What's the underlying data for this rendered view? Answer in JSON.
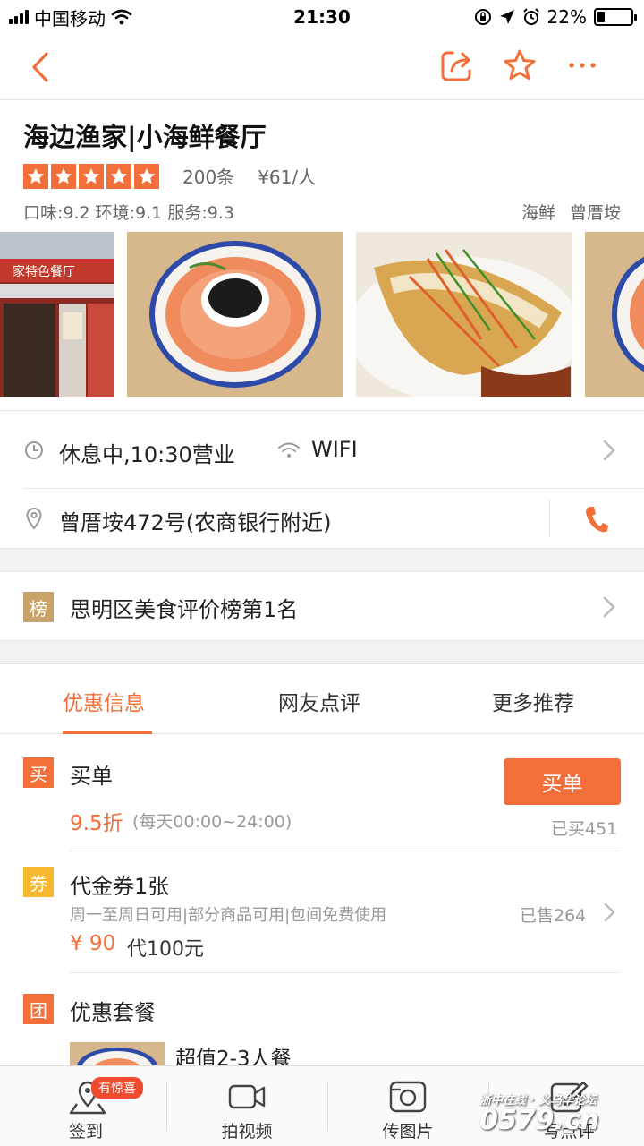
{
  "status_bar": {
    "carrier": "中国移动",
    "time": "21:30",
    "battery_percent_text": "22%",
    "battery_level": 0.22
  },
  "shop": {
    "title": "海边渔家|小海鲜餐厅",
    "rating_stars": 5,
    "review_count": "200条",
    "avg_price": "¥61/人",
    "scores": "口味:9.2 环境:9.1 服务:9.3",
    "tags": [
      "海鲜",
      "曾厝垵"
    ]
  },
  "photos": {
    "storefront_sign": "家特色餐厅"
  },
  "info": {
    "hours": "休息中,10:30营业",
    "wifi": "WIFI",
    "address": "曾厝垵472号(农商银行附近)"
  },
  "ranking": {
    "badge": "榜",
    "text": "思明区美食评价榜第1名"
  },
  "tabs": [
    "优惠信息",
    "网友点评",
    "更多推荐"
  ],
  "deals": {
    "buy": {
      "icon": "买",
      "title": "买单",
      "discount": "9.5折",
      "time_range": "(每天00:00~24:00)",
      "button": "买单",
      "bought": "已买451"
    },
    "voucher": {
      "icon": "券",
      "title": "代金券1张",
      "desc": "周一至周日可用|部分商品可用|包间免费使用",
      "sold": "已售264",
      "price": "¥ 90",
      "value": "代100元"
    },
    "package": {
      "icon": "团",
      "title": "优惠套餐",
      "item_title": "超值2-3人餐"
    }
  },
  "bottom_bar": {
    "items": [
      "签到",
      "拍视频",
      "传图片",
      "写点评"
    ],
    "badge": "有惊喜"
  },
  "watermark": {
    "line1": "浙中在线 · 义乌华论坛",
    "line2": "0579.cn"
  },
  "colors": {
    "accent": "#f36f3a",
    "ranking_badge": "#c9a46a",
    "voucher_icon": "#f5b82e",
    "buy_icon": "#f36f3a",
    "package_icon": "#f36f3a"
  }
}
